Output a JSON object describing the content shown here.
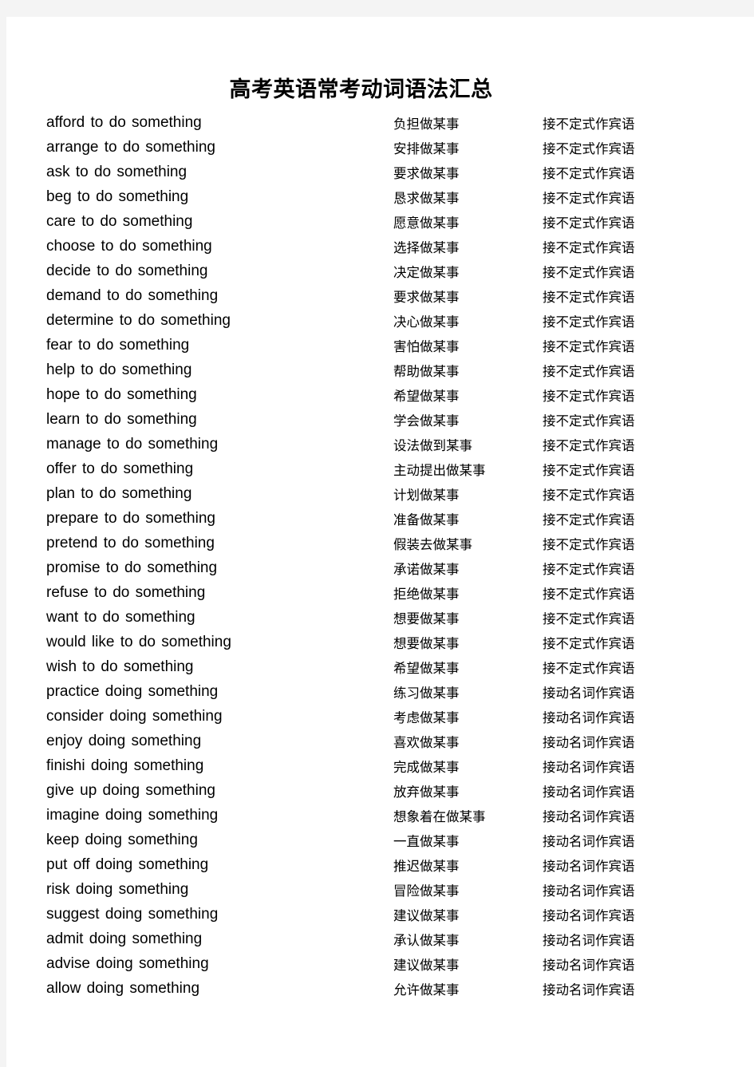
{
  "document": {
    "title": "高考英语常考动词语法汇总",
    "page_background": "#ffffff",
    "canvas_background": "#f4f4f4",
    "text_color": "#000000"
  },
  "table": {
    "columns": [
      "english_pattern",
      "chinese_meaning",
      "grammar_type"
    ],
    "rows": [
      {
        "en": "afford to do something",
        "cn": "负担做某事",
        "type": "接不定式作宾语"
      },
      {
        "en": "arrange to do something",
        "cn": "安排做某事",
        "type": "接不定式作宾语"
      },
      {
        "en": "ask to do something",
        "cn": "要求做某事",
        "type": "接不定式作宾语"
      },
      {
        "en": "beg to do something",
        "cn": "恳求做某事",
        "type": "接不定式作宾语"
      },
      {
        "en": "care to do something",
        "cn": "愿意做某事",
        "type": "接不定式作宾语"
      },
      {
        "en": "choose to do something",
        "cn": "选择做某事",
        "type": "接不定式作宾语"
      },
      {
        "en": "decide to do something",
        "cn": "决定做某事",
        "type": "接不定式作宾语"
      },
      {
        "en": "demand to do something",
        "cn": "要求做某事",
        "type": "接不定式作宾语"
      },
      {
        "en": "determine to do something",
        "cn": "决心做某事",
        "type": "接不定式作宾语"
      },
      {
        "en": "fear to do something",
        "cn": "害怕做某事",
        "type": "接不定式作宾语"
      },
      {
        "en": "help to do something",
        "cn": "帮助做某事",
        "type": "接不定式作宾语"
      },
      {
        "en": "hope to do something",
        "cn": "希望做某事",
        "type": "接不定式作宾语"
      },
      {
        "en": "learn to do something",
        "cn": "学会做某事",
        "type": "接不定式作宾语"
      },
      {
        "en": "manage to do something",
        "cn": "设法做到某事",
        "type": "接不定式作宾语"
      },
      {
        "en": "offer to do something",
        "cn": "主动提出做某事",
        "type": "接不定式作宾语"
      },
      {
        "en": "plan to do something",
        "cn": "计划做某事",
        "type": "接不定式作宾语"
      },
      {
        "en": "prepare to do something",
        "cn": "准备做某事",
        "type": "接不定式作宾语"
      },
      {
        "en": "pretend to do something",
        "cn": "假装去做某事",
        "type": "接不定式作宾语"
      },
      {
        "en": "promise to do something",
        "cn": "承诺做某事",
        "type": "接不定式作宾语"
      },
      {
        "en": "refuse to do something",
        "cn": "拒绝做某事",
        "type": "接不定式作宾语"
      },
      {
        "en": "want to do something",
        "cn": "想要做某事",
        "type": "接不定式作宾语"
      },
      {
        "en": "would like to do something",
        "cn": "想要做某事",
        "type": "接不定式作宾语"
      },
      {
        "en": "wish to do something",
        "cn": "希望做某事",
        "type": "接不定式作宾语"
      },
      {
        "en": "practice doing something",
        "cn": "练习做某事",
        "type": "接动名词作宾语"
      },
      {
        "en": "consider doing something",
        "cn": "考虑做某事",
        "type": "接动名词作宾语"
      },
      {
        "en": "enjoy doing something",
        "cn": "喜欢做某事",
        "type": "接动名词作宾语"
      },
      {
        "en": "finishi doing something",
        "cn": "完成做某事",
        "type": "接动名词作宾语"
      },
      {
        "en": "give up doing something",
        "cn": "放弃做某事",
        "type": "接动名词作宾语"
      },
      {
        "en": "imagine doing something",
        "cn": "想象着在做某事",
        "type": "接动名词作宾语"
      },
      {
        "en": "keep doing something",
        "cn": "一直做某事",
        "type": "接动名词作宾语"
      },
      {
        "en": "put off doing something",
        "cn": "推迟做某事",
        "type": "接动名词作宾语"
      },
      {
        "en": "risk doing something",
        "cn": "冒险做某事",
        "type": "接动名词作宾语"
      },
      {
        "en": "suggest doing something",
        "cn": "建议做某事",
        "type": "接动名词作宾语"
      },
      {
        "en": "admit doing something",
        "cn": "承认做某事",
        "type": "接动名词作宾语"
      },
      {
        "en": "advise doing something",
        "cn": "建议做某事",
        "type": "接动名词作宾语"
      },
      {
        "en": "allow doing something",
        "cn": "允许做某事",
        "type": "接动名词作宾语"
      }
    ]
  }
}
